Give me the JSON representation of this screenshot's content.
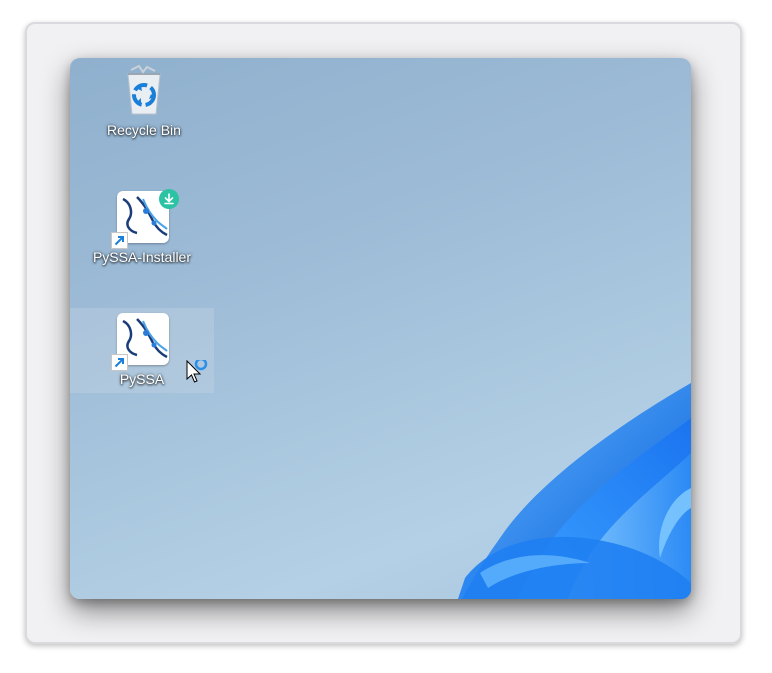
{
  "desktop": {
    "icons": [
      {
        "label": "Recycle Bin",
        "icon": "recycle-bin-icon"
      },
      {
        "label": "PySSA-Installer",
        "icon": "pyssa-installer-icon"
      },
      {
        "label": "PySSA",
        "icon": "pyssa-icon"
      }
    ]
  },
  "colors": {
    "wallpaper": "#9dbbd6",
    "bloom": "#1c7ff0",
    "badge": "#2bc3a4",
    "busy_ring": "#2b8fe8"
  }
}
